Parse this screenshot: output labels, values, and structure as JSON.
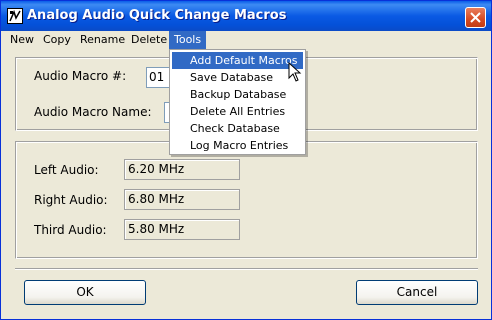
{
  "window": {
    "title": "Analog Audio Quick Change Macros"
  },
  "menubar": {
    "items": [
      "New",
      "Copy",
      "Rename",
      "Delete",
      "Tools"
    ],
    "active": "Tools"
  },
  "tools_menu": {
    "items": [
      "Add Default Macros",
      "Save Database",
      "Backup Database",
      "Delete All Entries",
      "Check Database",
      "Log Macro Entries"
    ],
    "highlighted": "Add Default Macros"
  },
  "macro": {
    "number_label": "Audio Macro #:",
    "number_value": "01",
    "name_label": "Audio Macro Name:"
  },
  "audio": {
    "left_label": "Left Audio:",
    "left_value": "6.20 MHz",
    "right_label": "Right Audio:",
    "right_value": "6.80 MHz",
    "third_label": "Third Audio:",
    "third_value": "5.80 MHz"
  },
  "buttons": {
    "ok": "OK",
    "cancel": "Cancel"
  },
  "icons": {
    "app": "app-icon",
    "close": "close-icon",
    "cursor": "mouse-pointer-icon"
  },
  "colors": {
    "titlebar": "#0a5ae4",
    "selection": "#316ac5",
    "close_button": "#d64a22"
  }
}
